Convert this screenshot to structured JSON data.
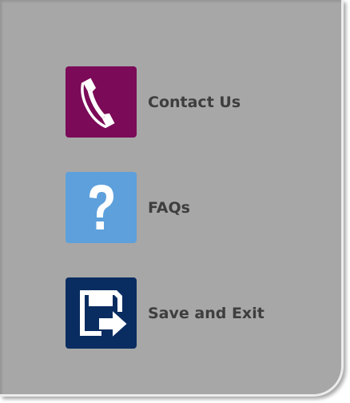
{
  "menu": {
    "items": [
      {
        "label": "Contact Us",
        "icon": "phone-icon",
        "color": "#7b0a58"
      },
      {
        "label": "FAQs",
        "icon": "question-icon",
        "color": "#5da0dc"
      },
      {
        "label": "Save and Exit",
        "icon": "save-exit-icon",
        "color": "#0a2d61"
      }
    ]
  },
  "colors": {
    "panel_background": "#a7a7a7",
    "label_text": "#3e3e3e"
  }
}
